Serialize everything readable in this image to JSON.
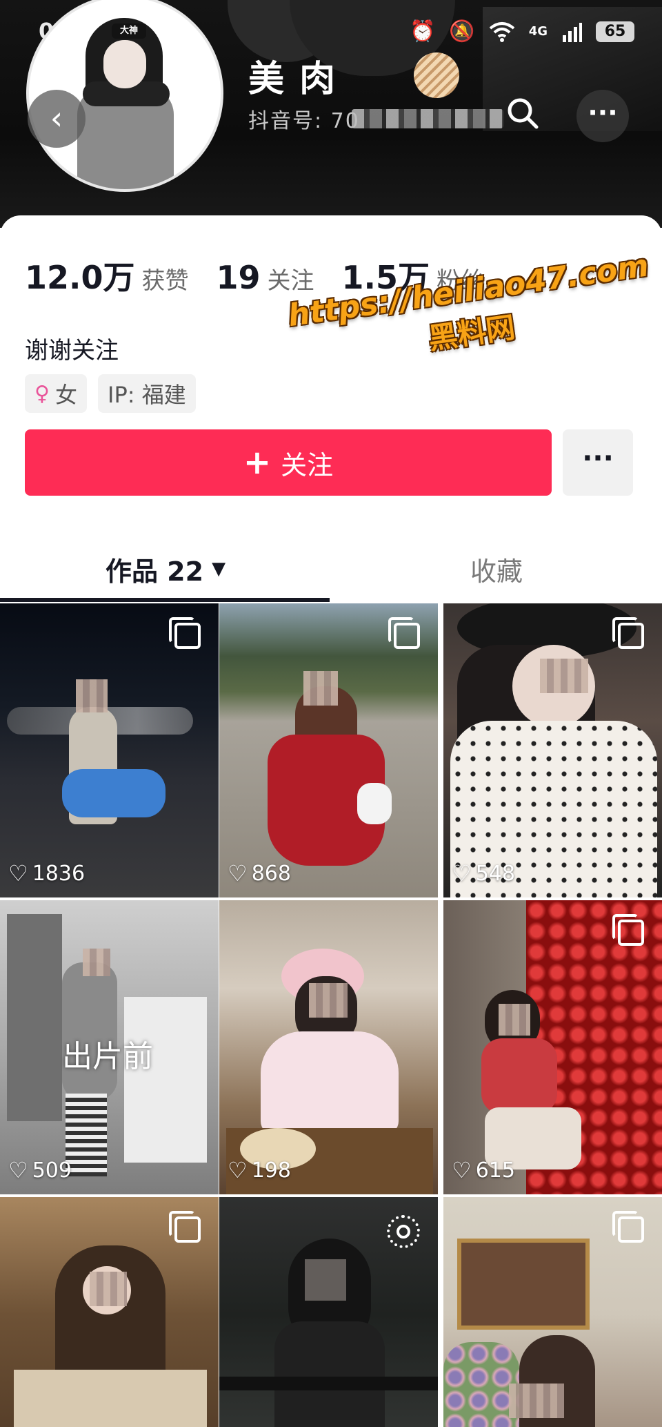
{
  "status_bar": {
    "time": "08:12",
    "network": "4G",
    "battery": "65"
  },
  "profile": {
    "username": "美  肉",
    "id_label": "抖音号: 70",
    "avatar_badge": "大神",
    "bio": "谢谢关注",
    "gender_tag": "女",
    "ip_tag": "IP: 福建"
  },
  "stats": [
    {
      "value": "12.0万",
      "label": "获赞"
    },
    {
      "value": "19",
      "label": "关注"
    },
    {
      "value": "1.5万",
      "label": "粉丝"
    }
  ],
  "actions": {
    "follow_label": "关注",
    "more_label": "···"
  },
  "watermark": {
    "url": "https://heiliao47.com",
    "name": "黑料网"
  },
  "tabs": {
    "works": "作品 22",
    "collect": "收藏"
  },
  "posts": [
    {
      "likes": "1836",
      "badge": "multi"
    },
    {
      "likes": "868",
      "badge": "multi"
    },
    {
      "likes": "548",
      "badge": "multi"
    },
    {
      "likes": "509",
      "badge": "none",
      "caption": "出片前"
    },
    {
      "likes": "198",
      "badge": "none"
    },
    {
      "likes": "615",
      "badge": "multi"
    },
    {
      "likes": "",
      "badge": "multi"
    },
    {
      "likes": "",
      "badge": "live"
    },
    {
      "likes": "",
      "badge": "multi"
    }
  ],
  "colors": {
    "accent": "#fe2c55",
    "watermark": "#f8a316",
    "header_bg": "#0c0c0c"
  }
}
